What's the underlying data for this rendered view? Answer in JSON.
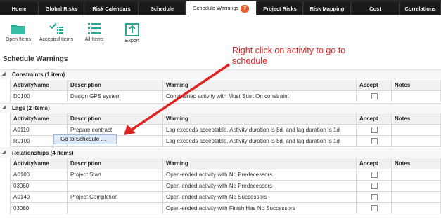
{
  "tabs": [
    {
      "label": "Home"
    },
    {
      "label": "Global Risks"
    },
    {
      "label": "Risk Calendars"
    },
    {
      "label": "Schedule"
    },
    {
      "label": "Schedule Warnings",
      "badge": "7"
    },
    {
      "label": "Project Risks"
    },
    {
      "label": "Risk Mapping"
    },
    {
      "label": "Cost"
    },
    {
      "label": "Correlations"
    }
  ],
  "toolbar": {
    "open_items": "Open Items",
    "accepted_items": "Accepted Items",
    "all_items": "All Items",
    "export": "Export"
  },
  "page_title": "Schedule Warnings",
  "columns": [
    "ActivityName",
    "Description",
    "Warning",
    "Accept",
    "Notes"
  ],
  "groups": [
    {
      "label": "Constraints (1 item)",
      "rows": [
        {
          "activity": "D0100",
          "description": "Design GPS system",
          "warning": "Constrained activity with Must Start On constraint"
        }
      ]
    },
    {
      "label": "Lags (2 items)",
      "rows": [
        {
          "activity": "A0110",
          "description": "Prepare contract",
          "warning": "Lag exceeds acceptable. Activity duration is 8d, and lag duration is 1d"
        },
        {
          "activity": "R0100",
          "description": "",
          "warning": "Lag exceeds acceptable. Activity duration is 8d, and lag duration is 1d"
        }
      ]
    },
    {
      "label": "Relationships (4 items)",
      "rows": [
        {
          "activity": "A0100",
          "description": "Project Start",
          "warning": "Open-ended activity with No Predecessors"
        },
        {
          "activity": "03060",
          "description": "",
          "warning": "Open-ended activity with No Predecessors"
        },
        {
          "activity": "A0140",
          "description": "Project Completion",
          "warning": "Open-ended activity with No Successors"
        },
        {
          "activity": "03080",
          "description": "",
          "warning": "Open-ended activity with Finish Has No Successors"
        }
      ]
    }
  ],
  "context_menu": {
    "item": "Go to Schedule ..."
  },
  "annotation": "Right click on activity to go to schedule",
  "colors": {
    "tabbar": "#262626",
    "badge": "#e8602c",
    "icon": "#2aa892",
    "annotation": "#e02424"
  }
}
